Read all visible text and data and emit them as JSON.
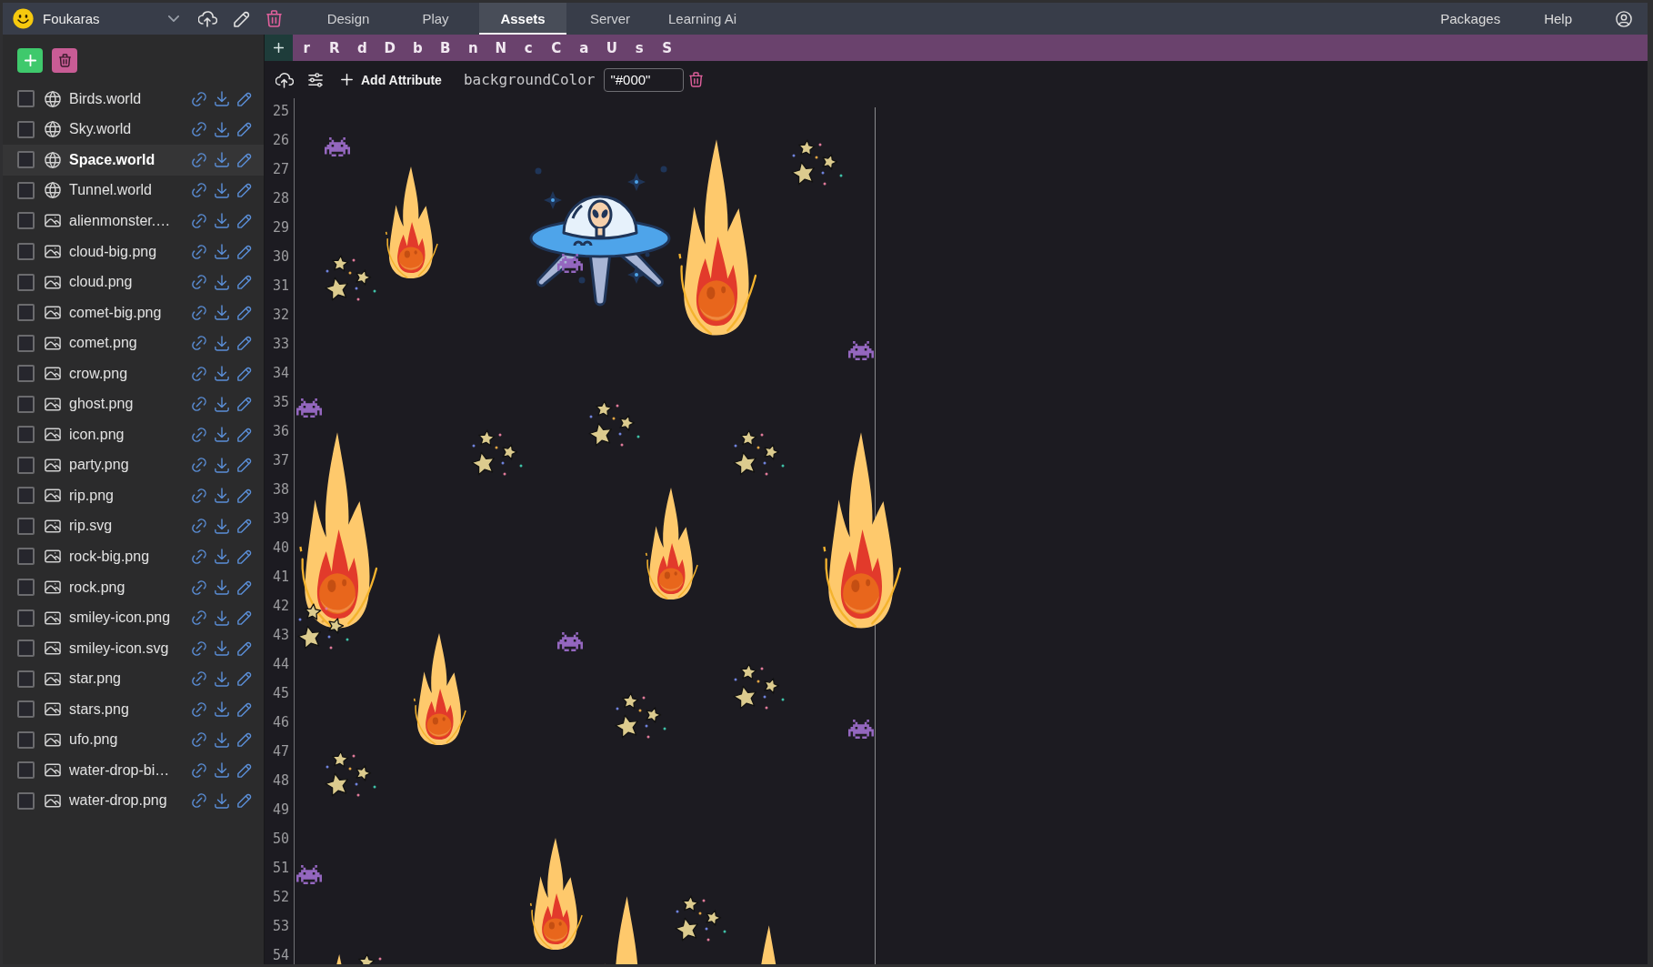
{
  "app_bar": {
    "project": "Foukaras",
    "tabs": [
      {
        "label": "Design",
        "selected": false
      },
      {
        "label": "Play",
        "selected": false
      },
      {
        "label": "Assets",
        "selected": true
      },
      {
        "label": "Server",
        "selected": false
      },
      {
        "label": "Learning Ai",
        "selected": false
      }
    ],
    "links": [
      "Packages",
      "Help"
    ]
  },
  "sidebar": {
    "items": [
      {
        "name": "Birds.world",
        "kind": "world",
        "checked": false,
        "selected": false
      },
      {
        "name": "Sky.world",
        "kind": "world",
        "checked": false,
        "selected": false
      },
      {
        "name": "Space.world",
        "kind": "world",
        "checked": false,
        "selected": true
      },
      {
        "name": "Tunnel.world",
        "kind": "world",
        "checked": false,
        "selected": false
      },
      {
        "name": "alienmonster.…",
        "kind": "image",
        "checked": false,
        "selected": false
      },
      {
        "name": "cloud-big.png",
        "kind": "image",
        "checked": false,
        "selected": false
      },
      {
        "name": "cloud.png",
        "kind": "image",
        "checked": false,
        "selected": false
      },
      {
        "name": "comet-big.png",
        "kind": "image",
        "checked": false,
        "selected": false
      },
      {
        "name": "comet.png",
        "kind": "image",
        "checked": false,
        "selected": false
      },
      {
        "name": "crow.png",
        "kind": "image",
        "checked": false,
        "selected": false
      },
      {
        "name": "ghost.png",
        "kind": "image",
        "checked": false,
        "selected": false
      },
      {
        "name": "icon.png",
        "kind": "image",
        "checked": false,
        "selected": false
      },
      {
        "name": "party.png",
        "kind": "image",
        "checked": false,
        "selected": false
      },
      {
        "name": "rip.png",
        "kind": "image",
        "checked": false,
        "selected": false
      },
      {
        "name": "rip.svg",
        "kind": "image",
        "checked": false,
        "selected": false
      },
      {
        "name": "rock-big.png",
        "kind": "image",
        "checked": false,
        "selected": false
      },
      {
        "name": "rock.png",
        "kind": "image",
        "checked": false,
        "selected": false
      },
      {
        "name": "smiley-icon.png",
        "kind": "image",
        "checked": false,
        "selected": false
      },
      {
        "name": "smiley-icon.svg",
        "kind": "image",
        "checked": false,
        "selected": false
      },
      {
        "name": "star.png",
        "kind": "image",
        "checked": false,
        "selected": false
      },
      {
        "name": "stars.png",
        "kind": "image",
        "checked": false,
        "selected": false
      },
      {
        "name": "ufo.png",
        "kind": "image",
        "checked": false,
        "selected": false
      },
      {
        "name": "water-drop-bi…",
        "kind": "image",
        "checked": false,
        "selected": false
      },
      {
        "name": "water-drop.png",
        "kind": "image",
        "checked": false,
        "selected": false
      }
    ]
  },
  "key_bar": {
    "keys": [
      "r",
      "R",
      "d",
      "D",
      "b",
      "B",
      "n",
      "N",
      "c",
      "C",
      "a",
      "U",
      "s",
      "S"
    ]
  },
  "attribute_bar": {
    "button_label": "Add Attribute",
    "attribute_name": "backgroundColor",
    "attribute_value": "\"#000\""
  },
  "editor": {
    "line_numbers": [
      "25",
      "26",
      "27",
      "28",
      "29",
      "30",
      "31",
      "32",
      "33",
      "34",
      "35",
      "36",
      "37",
      "38",
      "39",
      "40",
      "41",
      "42",
      "43",
      "44",
      "45",
      "46",
      "47",
      "48",
      "49",
      "50",
      "51",
      "52",
      "53",
      "54"
    ]
  }
}
